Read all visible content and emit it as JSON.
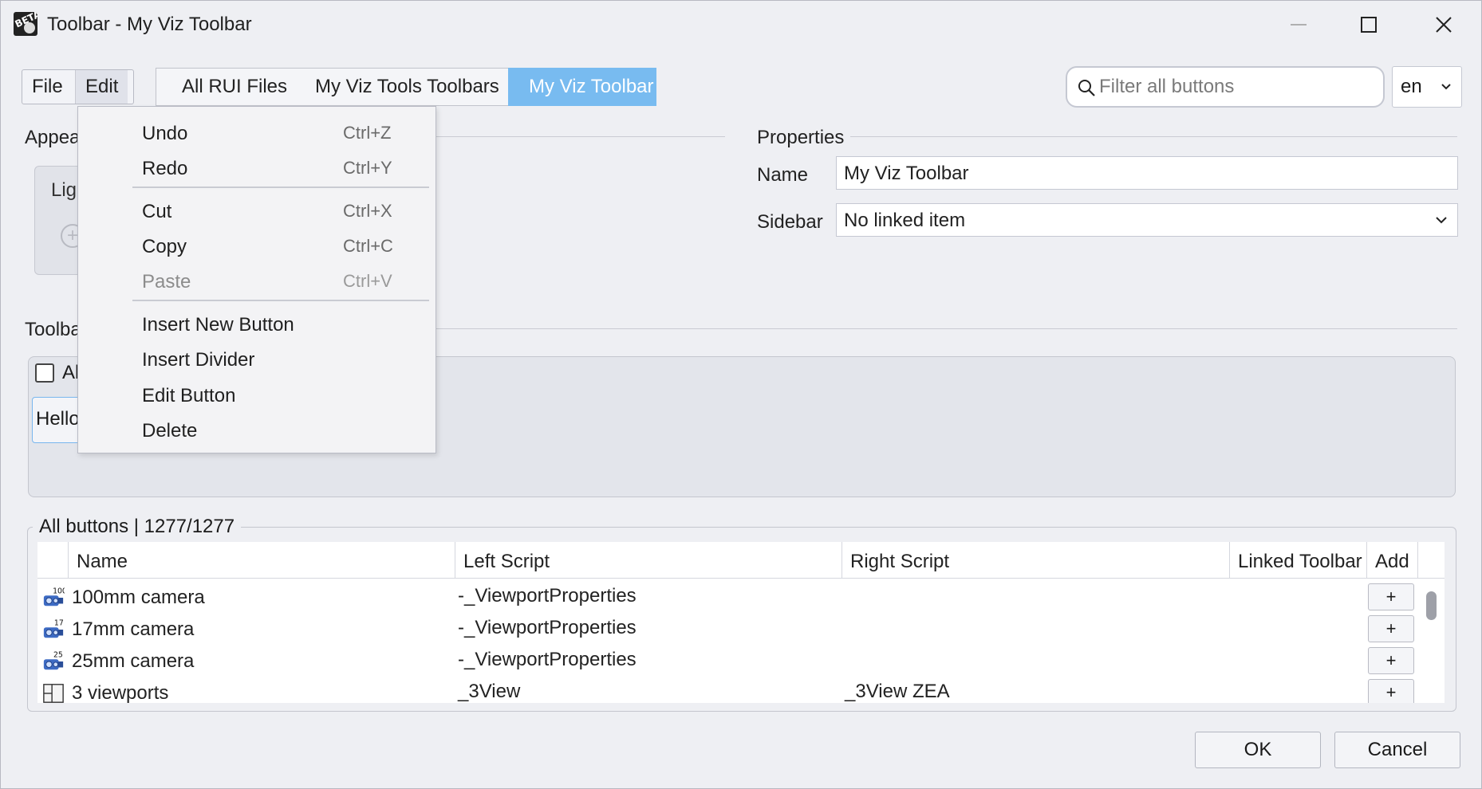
{
  "window": {
    "title": "Toolbar - My Viz Toolbar",
    "app_icon_text": "BETA"
  },
  "menubar": {
    "file": "File",
    "edit": "Edit"
  },
  "breadcrumb": {
    "items": [
      "All RUI Files",
      "My Viz Tools Toolbars",
      "My Viz Toolbar"
    ]
  },
  "search": {
    "placeholder": "Filter all buttons",
    "value": ""
  },
  "language": {
    "selected": "en"
  },
  "appearance": {
    "label": "Appea",
    "preview_text": "Lig"
  },
  "properties": {
    "label": "Properties",
    "name_label": "Name",
    "name_value": "My Viz Toolbar",
    "sidebar_label": "Sidebar",
    "sidebar_value": "No linked item"
  },
  "toolbar_section": {
    "label": "Toolba",
    "checkbox_label": "Al",
    "button_text": "Hello"
  },
  "all_buttons": {
    "label": "All buttons | 1277/1277",
    "columns": [
      "Name",
      "Left Script",
      "Right Script",
      "Linked Toolbar",
      "Add"
    ],
    "rows": [
      {
        "icon": "camera-icon",
        "icon_badge": "100",
        "name": "100mm camera",
        "left": "-_ViewportProperties",
        "right": "",
        "linked": "",
        "add": "+"
      },
      {
        "icon": "camera-icon",
        "icon_badge": "17",
        "name": "17mm camera",
        "left": "-_ViewportProperties",
        "right": "",
        "linked": "",
        "add": "+"
      },
      {
        "icon": "camera-icon",
        "icon_badge": "25",
        "name": "25mm camera",
        "left": "-_ViewportProperties",
        "right": "",
        "linked": "",
        "add": "+"
      },
      {
        "icon": "viewports-icon",
        "icon_badge": "",
        "name": "3 viewports",
        "left": "_3View",
        "right": "_3View ZEA",
        "linked": "",
        "add": "+"
      }
    ]
  },
  "edit_menu": {
    "items": [
      {
        "label": "Undo",
        "shortcut": "Ctrl+Z",
        "enabled": true
      },
      {
        "label": "Redo",
        "shortcut": "Ctrl+Y",
        "enabled": true
      },
      {
        "label": "Cut",
        "shortcut": "Ctrl+X",
        "enabled": true
      },
      {
        "label": "Copy",
        "shortcut": "Ctrl+C",
        "enabled": true
      },
      {
        "label": "Paste",
        "shortcut": "Ctrl+V",
        "enabled": false
      },
      {
        "label": "Insert New Button",
        "shortcut": "",
        "enabled": true
      },
      {
        "label": "Insert Divider",
        "shortcut": "",
        "enabled": true
      },
      {
        "label": "Edit Button",
        "shortcut": "",
        "enabled": true
      },
      {
        "label": "Delete",
        "shortcut": "",
        "enabled": true
      }
    ]
  },
  "dialog": {
    "ok": "OK",
    "cancel": "Cancel"
  },
  "colors": {
    "accent": "#78bbf0",
    "background": "#eeeff3",
    "disabled_text": "#8c8c8c"
  }
}
